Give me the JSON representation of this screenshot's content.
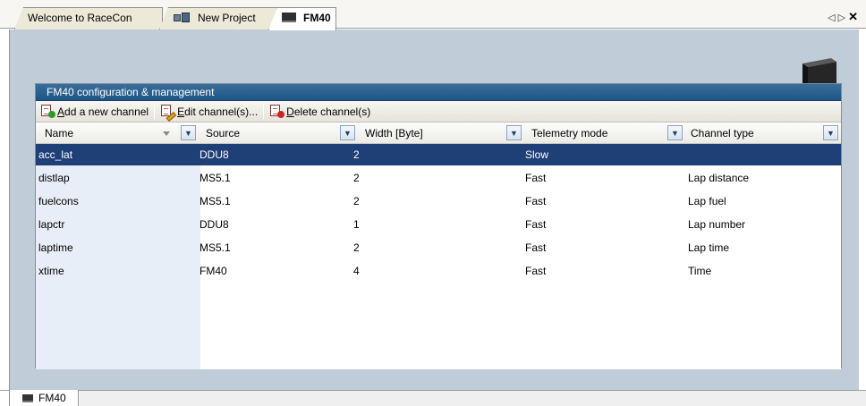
{
  "tabs": [
    {
      "label": "Welcome to RaceCon",
      "icon": "none",
      "active": false
    },
    {
      "label": "New Project",
      "icon": "network-group-icon",
      "active": false
    },
    {
      "label": "FM40",
      "icon": "device-icon",
      "active": true
    }
  ],
  "tab_controls": {
    "prev": "◁",
    "next": "▷",
    "close": "✕"
  },
  "config": {
    "title": "FM40 configuration & management"
  },
  "toolbar": {
    "add_label": "Add a new channel",
    "edit_label": "Edit channel(s)...",
    "delete_label": "Delete channel(s)"
  },
  "grid": {
    "columns": [
      "Name",
      "Source",
      "Width [Byte]",
      "Telemetry mode",
      "Channel type"
    ],
    "rows": [
      {
        "name": "acc_lat",
        "source": "DDU8",
        "width": "2",
        "telemetry": "Slow",
        "type": "",
        "selected": true
      },
      {
        "name": "distlap",
        "source": "MS5.1",
        "width": "2",
        "telemetry": "Fast",
        "type": "Lap distance",
        "selected": false
      },
      {
        "name": "fuelcons",
        "source": "MS5.1",
        "width": "2",
        "telemetry": "Fast",
        "type": "Lap fuel",
        "selected": false
      },
      {
        "name": "lapctr",
        "source": "DDU8",
        "width": "1",
        "telemetry": "Fast",
        "type": "Lap number",
        "selected": false
      },
      {
        "name": "laptime",
        "source": "MS5.1",
        "width": "2",
        "telemetry": "Fast",
        "type": "Lap time",
        "selected": false
      },
      {
        "name": "xtime",
        "source": "FM40",
        "width": "4",
        "telemetry": "Fast",
        "type": "Time",
        "selected": false
      }
    ]
  },
  "bottom_tab": {
    "label": "FM40"
  },
  "colors": {
    "title_bar": "#1e5585",
    "selected_row": "#1f3f77",
    "panel_bg": "#c0ccd8"
  }
}
